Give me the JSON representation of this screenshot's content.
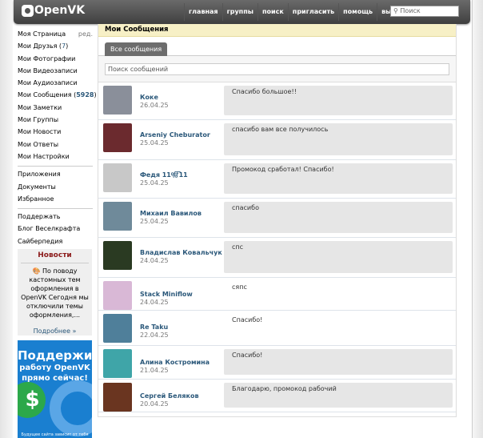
{
  "header": {
    "logo": "OpenVK",
    "nav": [
      "главная",
      "группы",
      "поиск",
      "пригласить",
      "помощь",
      "выйти"
    ],
    "search_placeholder": "Поиск"
  },
  "sidebar": {
    "items": [
      {
        "label": "Моя Страница",
        "extra": "ред."
      },
      {
        "label": "Мои Друзья",
        "count": "7"
      },
      {
        "label": "Мои Фотографии"
      },
      {
        "label": "Мои Видеозаписи"
      },
      {
        "label": "Мои Аудиозаписи"
      },
      {
        "label": "Мои Сообщения",
        "count": "5928"
      },
      {
        "label": "Мои Заметки"
      },
      {
        "label": "Мои Группы"
      },
      {
        "label": "Мои Новости"
      },
      {
        "label": "Мои Ответы"
      },
      {
        "label": "Мои Настройки"
      }
    ],
    "items2": [
      "Приложения",
      "Документы",
      "Избранное"
    ],
    "items3": [
      "Поддержать",
      "Блог Веселкрафта",
      "Сайберпедия"
    ]
  },
  "news": {
    "title": "Новости",
    "text": "По поводу кастомных тем оформления в OpenVK Сегодня мы отключили темы оформления,...",
    "more": "Подробнее »"
  },
  "ad": {
    "line1": "Поддержи",
    "line2": "работу OpenVK прямо сейчас!",
    "small": "Будущее сайта зависит от тебя"
  },
  "main": {
    "title": "Мои Сообщения",
    "tab": "Все сообщения",
    "search_placeholder": "Поиск сообщений",
    "conversations": [
      {
        "name": "Коке",
        "date": "26.04.25",
        "message": "Спасибо большое!!",
        "unread": true,
        "color": "#8a8f9a"
      },
      {
        "name": "Arseniy Cheburator",
        "date": "25.04.25",
        "message": "спасибо вам все получилось",
        "unread": true,
        "color": "#6b2a2e"
      },
      {
        "name": "Федя 11ੴ11",
        "date": "25.04.25",
        "message": "Промокод сработал! Спасибо!",
        "unread": true,
        "color": "#c8c8c8"
      },
      {
        "name": "Михаил Вавилов",
        "date": "25.04.25",
        "message": "спасибо",
        "unread": true,
        "color": "#6f8a9a"
      },
      {
        "name": "Владислав Ковальчук",
        "date": "24.04.25",
        "message": "спс",
        "unread": true,
        "color": "#2a3a22"
      },
      {
        "name": "Stack Miniflow",
        "date": "24.04.25",
        "message": "сяпс",
        "unread": false,
        "color": "#d9b8d6"
      },
      {
        "name": "Re Taku",
        "date": "22.04.25",
        "message": "Спасибо!",
        "unread": false,
        "color": "#4f7f9a"
      },
      {
        "name": "Алина Костромина",
        "date": "21.04.25",
        "message": "Спасибо!",
        "unread": true,
        "color": "#3fa5a8"
      },
      {
        "name": "Сергей Беляков",
        "date": "20.04.25",
        "message": "Благодарю, промокод рабочий",
        "unread": true,
        "color": "#6a3520"
      }
    ]
  }
}
